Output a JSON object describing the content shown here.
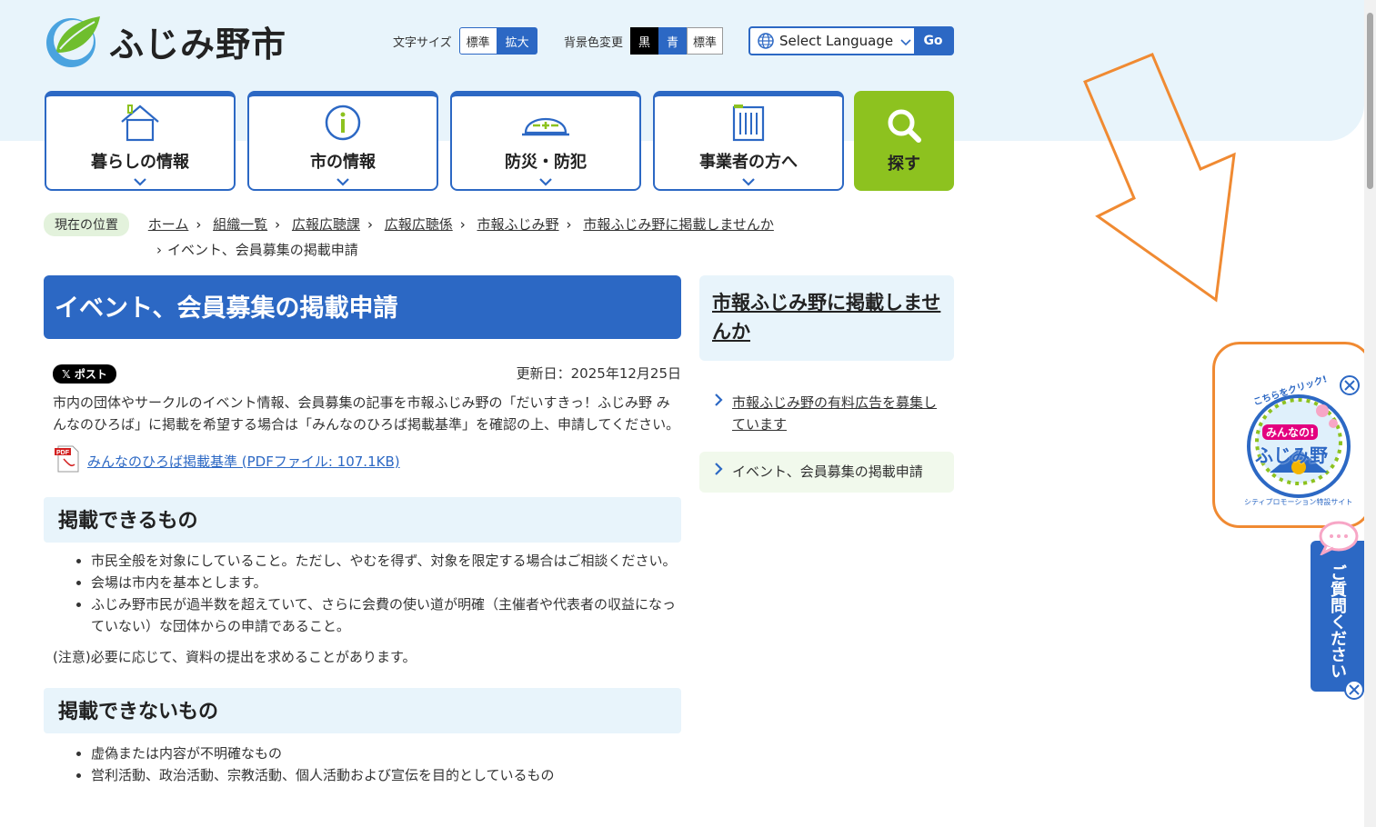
{
  "header": {
    "site_name": "ふじみ野市",
    "font_size_label": "文字サイズ",
    "font_size_standard": "標準",
    "font_size_large": "拡大",
    "bg_color_label": "背景色変更",
    "bg_black": "黒",
    "bg_blue": "青",
    "bg_standard": "標準",
    "language_select": "Select Language",
    "go_button": "Go"
  },
  "nav": {
    "items": [
      {
        "label": "暮らしの情報",
        "icon": "house-icon"
      },
      {
        "label": "市の情報",
        "icon": "info-icon"
      },
      {
        "label": "防災・防犯",
        "icon": "helmet-icon"
      },
      {
        "label": "事業者の方へ",
        "icon": "building-icon"
      }
    ],
    "search_label": "探す"
  },
  "breadcrumb": {
    "here_label": "現在の位置",
    "items": [
      "ホーム",
      "組織一覧",
      "広報広聴課",
      "広報広聴係",
      "市報ふじみ野",
      "市報ふじみ野に掲載しませんか"
    ],
    "current": "イベント、会員募集の掲載申請"
  },
  "main": {
    "title": "イベント、会員募集の掲載申請",
    "x_post": "ポスト",
    "updated": "更新日：2025年12月25日",
    "intro": "市内の団体やサークルのイベント情報、会員募集の記事を市報ふじみ野の「だいすきっ！ふじみ野 みんなのひろば」に掲載を希望する場合は「みんなのひろば掲載基準」を確認の上、申請してください。",
    "pdf_link": "みんなのひろば掲載基準 (PDFファイル: 107.1KB)",
    "sec1_title": "掲載できるもの",
    "sec1_items": [
      "市民全般を対象にしていること。ただし、やむを得ず、対象を限定する場合はご相談ください。",
      "会場は市内を基本とします。",
      "ふじみ野市民が過半数を超えていて、さらに会費の使い道が明確（主催者や代表者の収益になっていない）な団体からの申請であること。"
    ],
    "note": "(注意)必要に応じて、資料の提出を求めることがあります。",
    "sec2_title": "掲載できないもの",
    "sec2_items": [
      "虚偽または内容が不明確なもの",
      "営利活動、政治活動、宗教活動、個人活動および宣伝を目的としているもの"
    ]
  },
  "side": {
    "title": "市報ふじみ野に掲載しませんか",
    "links": [
      "市報ふじみ野の有料広告を募集しています",
      "イベント、会員募集の掲載申請"
    ]
  },
  "banner": {
    "top_text": "こちらをクリック!",
    "line1": "みんなの!",
    "line2": "ふじみ野",
    "bottom_text": "シティプロモーション特設サイト"
  },
  "question_tab": {
    "label": "ご質問ください"
  },
  "colors": {
    "brand_blue": "#2c68c4",
    "green": "#8dc21f",
    "orange": "#f08a32",
    "light_blue": "#e8f4fb"
  }
}
